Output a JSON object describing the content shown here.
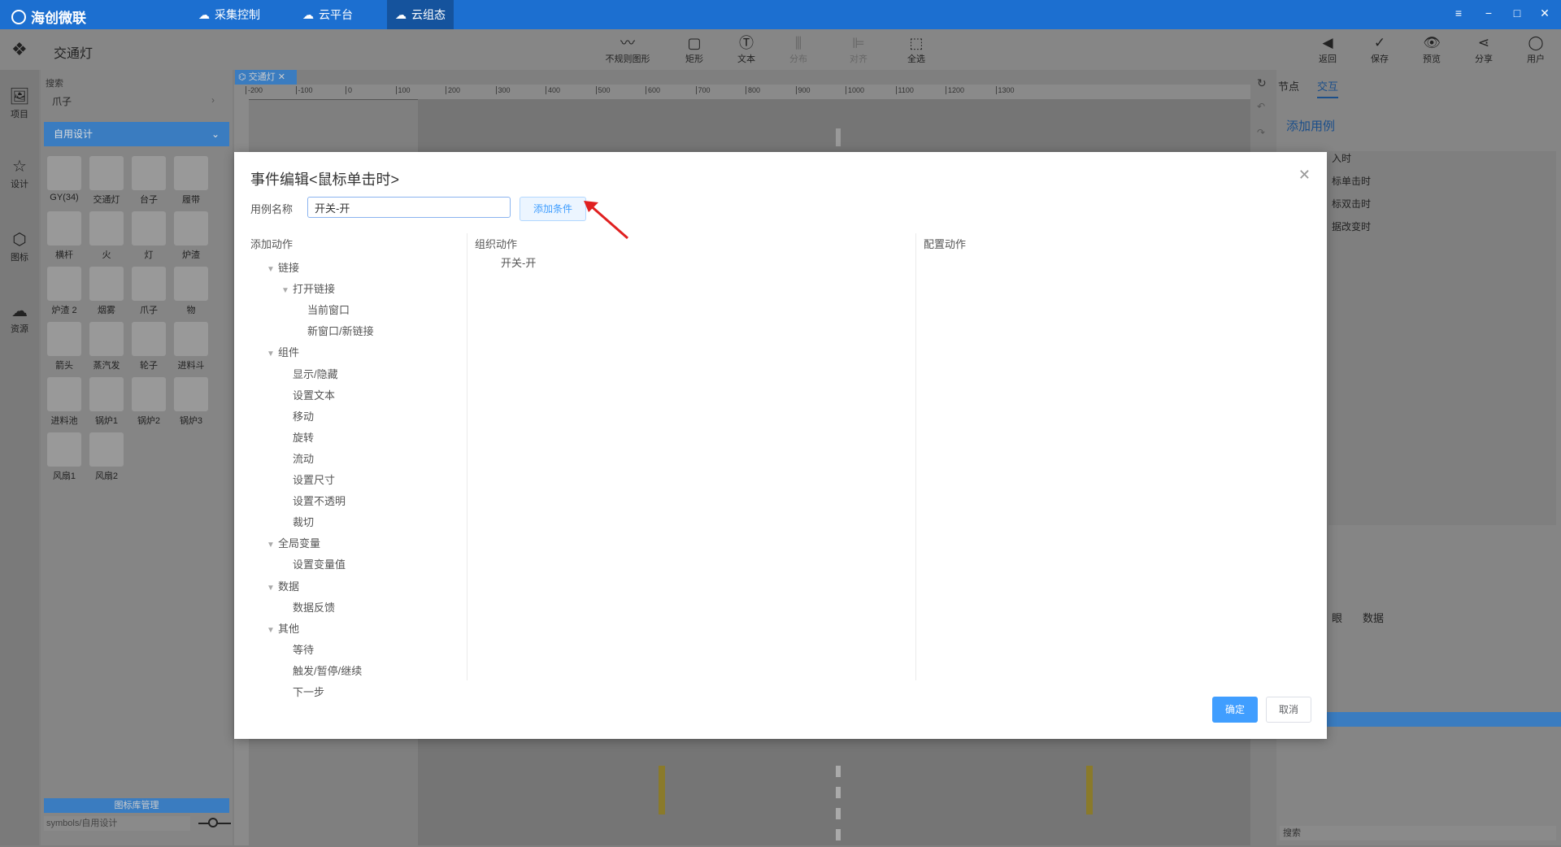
{
  "brand": "海创微联",
  "nav_tabs": [
    {
      "label": "采集控制",
      "icon": "cloud-gear-icon"
    },
    {
      "label": "云平台",
      "icon": "cloud-icon"
    },
    {
      "label": "云组态",
      "icon": "cloud-config-icon"
    }
  ],
  "project_title": "交通灯",
  "toolbar": [
    "不规则图形",
    "矩形",
    "文本",
    "分布",
    "对齐",
    "全选"
  ],
  "right_toolbar": [
    "返回",
    "保存",
    "预览",
    "分享",
    "用户"
  ],
  "left_nav": [
    "项目",
    "设计",
    "图标",
    "资源"
  ],
  "library": {
    "search_label": "搜索",
    "search_value": "爪子",
    "category": "自用设计",
    "items": [
      "GY(34)",
      "交通灯",
      "台子",
      "履带",
      "横杆",
      "火",
      "灯",
      "炉渣",
      "炉渣 2",
      "烟雾",
      "爪子",
      "物",
      "箭头",
      "蒸汽发",
      "轮子",
      "进料斗",
      "进料池",
      "锅炉1",
      "锅炉2",
      "锅炉3",
      "风扇1",
      "风扇2"
    ],
    "manage_label": "图标库管理",
    "path": "symbols/自用设计"
  },
  "canvas_tab": "交通灯",
  "ruler": [
    "-200",
    "-100",
    "0",
    "100",
    "200",
    "300",
    "400",
    "500",
    "600",
    "700",
    "800",
    "900",
    "1000",
    "1100",
    "1200",
    "1300"
  ],
  "right_panel": {
    "tabs": [
      "节点",
      "交互"
    ],
    "add_case": "添加用例",
    "events": [
      "入时",
      "标单击时",
      "标双击时",
      "据改变时"
    ],
    "sub_tabs": [
      "眼",
      "数据"
    ],
    "search": "搜索"
  },
  "modal": {
    "title": "事件编辑<鼠标单击时>",
    "name_label": "用例名称",
    "name_value": "开关-开",
    "add_condition": "添加条件",
    "col_add": "添加动作",
    "col_org": "组织动作",
    "col_cfg": "配置动作",
    "org_item": "开关-开",
    "tree": [
      {
        "label": "链接",
        "level": 0,
        "toggle": true
      },
      {
        "label": "打开链接",
        "level": 1,
        "toggle": true
      },
      {
        "label": "当前窗口",
        "level": 2,
        "toggle": false
      },
      {
        "label": "新窗口/新链接",
        "level": 2,
        "toggle": false
      },
      {
        "label": "组件",
        "level": 0,
        "toggle": true
      },
      {
        "label": "显示/隐藏",
        "level": 1,
        "toggle": false
      },
      {
        "label": "设置文本",
        "level": 1,
        "toggle": false
      },
      {
        "label": "移动",
        "level": 1,
        "toggle": false
      },
      {
        "label": "旋转",
        "level": 1,
        "toggle": false
      },
      {
        "label": "流动",
        "level": 1,
        "toggle": false
      },
      {
        "label": "设置尺寸",
        "level": 1,
        "toggle": false
      },
      {
        "label": "设置不透明",
        "level": 1,
        "toggle": false
      },
      {
        "label": "裁切",
        "level": 1,
        "toggle": false
      },
      {
        "label": "全局变量",
        "level": 0,
        "toggle": true
      },
      {
        "label": "设置变量值",
        "level": 1,
        "toggle": false
      },
      {
        "label": "数据",
        "level": 0,
        "toggle": true
      },
      {
        "label": "数据反馈",
        "level": 1,
        "toggle": false
      },
      {
        "label": "其他",
        "level": 0,
        "toggle": true
      },
      {
        "label": "等待",
        "level": 1,
        "toggle": false
      },
      {
        "label": "触发/暂停/继续",
        "level": 1,
        "toggle": false
      },
      {
        "label": "下一步",
        "level": 1,
        "toggle": false
      }
    ],
    "ok": "确定",
    "cancel": "取消"
  }
}
